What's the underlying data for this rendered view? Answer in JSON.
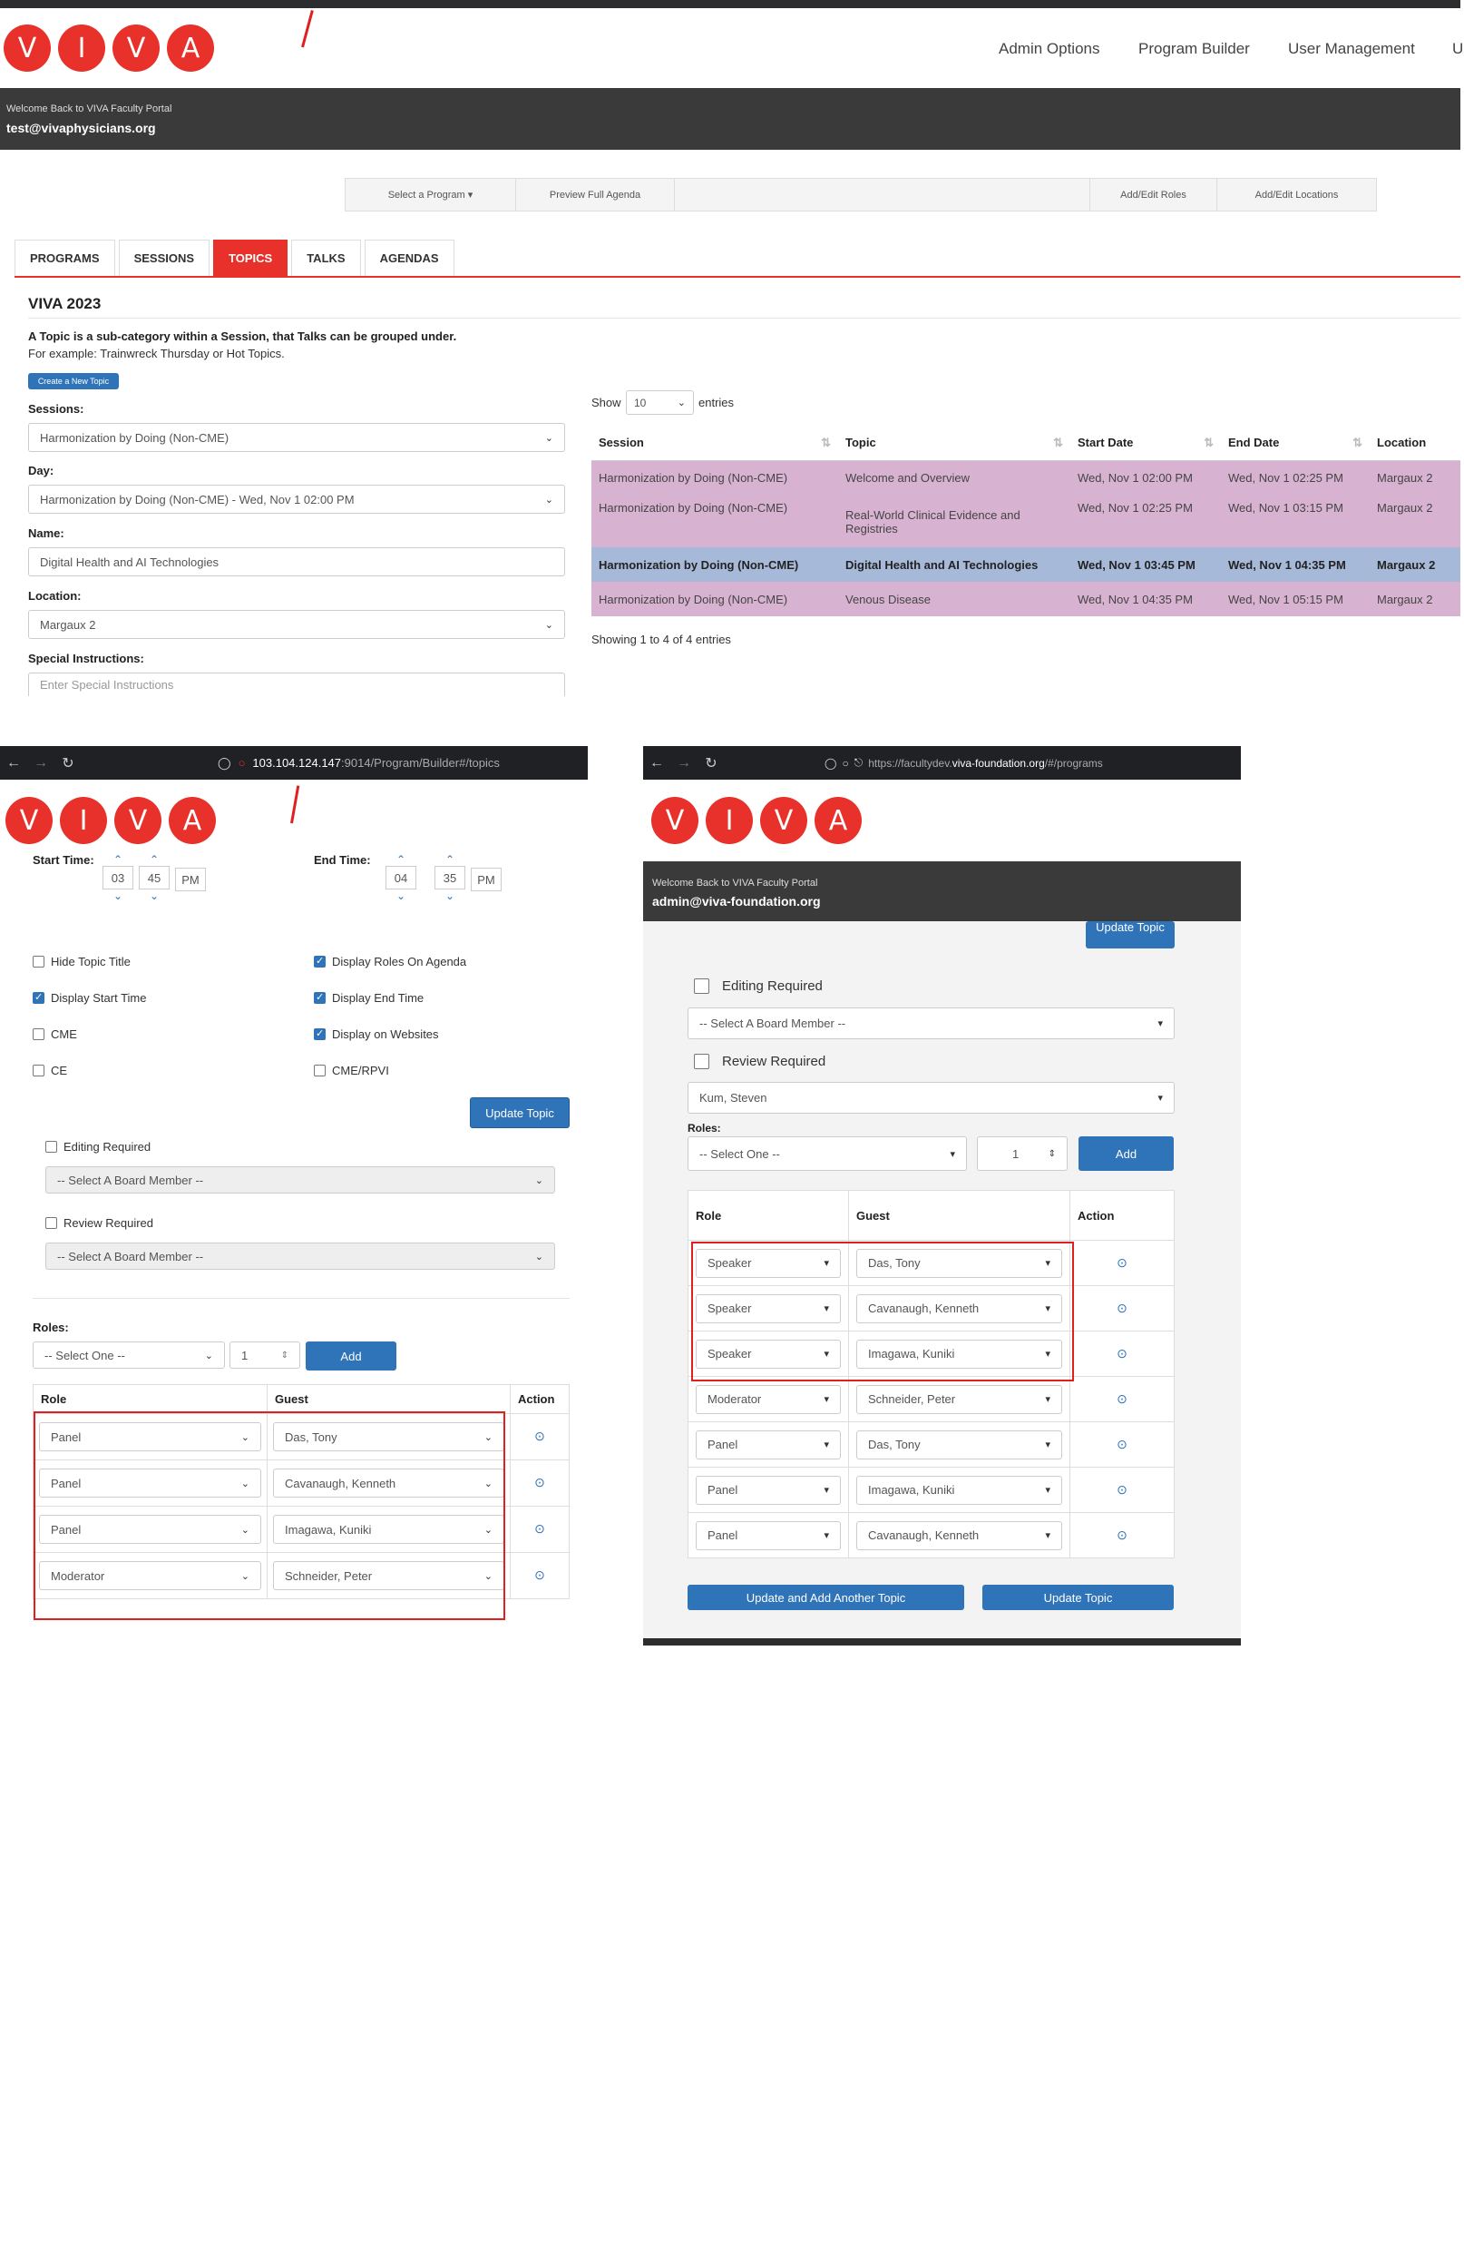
{
  "top": {
    "logo_letters": [
      "V",
      "I",
      "V",
      "A"
    ],
    "nav": [
      "Admin Options",
      "Program Builder",
      "User Management",
      "U"
    ],
    "welcome": "Welcome Back to VIVA Faculty Portal",
    "email": "test@vivaphysicians.org",
    "toolbar": [
      "Select a Program ▾",
      "Preview Full Agenda",
      "",
      "Add/Edit Roles",
      "Add/Edit Locations"
    ],
    "tabs": [
      "PROGRAMS",
      "SESSIONS",
      "TOPICS",
      "TALKS",
      "AGENDAS"
    ],
    "heading": "VIVA 2023",
    "desc_bold": "A Topic is a sub-category within a Session, that Talks can be grouped under.",
    "desc_example": "For example: Trainwreck Thursday or Hot Topics.",
    "create_button": "Create a New Topic",
    "form": {
      "sessions_label": "Sessions:",
      "sessions_value": "Harmonization by Doing (Non-CME)",
      "day_label": "Day:",
      "day_value": "Harmonization by Doing (Non-CME) - Wed, Nov 1 02:00 PM",
      "name_label": "Name:",
      "name_value": "Digital Health and AI Technologies",
      "location_label": "Location:",
      "location_value": "Margaux 2",
      "special_label": "Special Instructions:",
      "special_placeholder": "Enter Special Instructions"
    },
    "table": {
      "show_label": "Show",
      "show_value": "10",
      "entries_label": "entries",
      "headers": [
        "Session",
        "Topic",
        "Start Date",
        "End Date",
        "Location"
      ],
      "rows": [
        [
          "Harmonization by Doing (Non-CME)",
          "Welcome and Overview",
          "Wed, Nov 1 02:00 PM",
          "Wed, Nov 1 02:25 PM",
          "Margaux 2"
        ],
        [
          "Harmonization by Doing (Non-CME)",
          "Real-World Clinical Evidence and Registries",
          "Wed, Nov 1 02:25 PM",
          "Wed, Nov 1 03:15 PM",
          "Margaux 2"
        ],
        [
          "Harmonization by Doing (Non-CME)",
          "Digital Health and AI Technologies",
          "Wed, Nov 1 03:45 PM",
          "Wed, Nov 1 04:35 PM",
          "Margaux 2"
        ],
        [
          "Harmonization by Doing (Non-CME)",
          "Venous Disease",
          "Wed, Nov 1 04:35 PM",
          "Wed, Nov 1 05:15 PM",
          "Margaux 2"
        ]
      ],
      "footer": "Showing 1 to 4 of 4 entries"
    }
  },
  "left": {
    "url_host": "103.104.124.147",
    "url_rest": ":9014/Program/Builder#/topics",
    "start_label": "Start Time:",
    "start_h": "03",
    "start_m": "45",
    "start_ampm": "PM",
    "end_label": "End Time:",
    "end_h": "04",
    "end_m": "35",
    "end_ampm": "PM",
    "checks": [
      {
        "label": "Hide Topic Title",
        "checked": false
      },
      {
        "label": "Display Roles On Agenda",
        "checked": true
      },
      {
        "label": "Display Start Time",
        "checked": true
      },
      {
        "label": "Display End Time",
        "checked": true
      },
      {
        "label": "CME",
        "checked": false
      },
      {
        "label": "Display on Websites",
        "checked": true
      },
      {
        "label": "CE",
        "checked": false
      },
      {
        "label": "CME/RPVI",
        "checked": false
      }
    ],
    "update_button": "Update Topic",
    "editing_label": "Editing Required",
    "board_placeholder": "-- Select A Board Member --",
    "review_label": "Review Required",
    "review_placeholder": "-- Select A Board Member --",
    "roles_label": "Roles:",
    "roles_select": "-- Select One --",
    "roles_qty": "1",
    "add_button": "Add",
    "table_headers": [
      "Role",
      "Guest",
      "Action"
    ],
    "rows": [
      [
        "Panel",
        "Das, Tony"
      ],
      [
        "Panel",
        "Cavanaugh, Kenneth"
      ],
      [
        "Panel",
        "Imagawa, Kuniki"
      ],
      [
        "Moderator",
        "Schneider, Peter"
      ]
    ]
  },
  "right": {
    "url_prefix": "https://facultydev.",
    "url_host": "viva-foundation.org",
    "url_rest": "/#/programs",
    "welcome": "Welcome Back to VIVA Faculty Portal",
    "email": "admin@viva-foundation.org",
    "update_top_button": "Update Topic",
    "editing_label": "Editing Required",
    "board_placeholder": "-- Select A Board Member --",
    "review_label": "Review Required",
    "review_value": "Kum, Steven",
    "roles_label": "Roles:",
    "roles_select": "-- Select One --",
    "roles_qty": "1",
    "add_button": "Add",
    "table_headers": [
      "Role",
      "Guest",
      "Action"
    ],
    "rows": [
      [
        "Speaker",
        "Das, Tony"
      ],
      [
        "Speaker",
        "Cavanaugh, Kenneth"
      ],
      [
        "Speaker",
        "Imagawa, Kuniki"
      ],
      [
        "Moderator",
        "Schneider, Peter"
      ],
      [
        "Panel",
        "Das, Tony"
      ],
      [
        "Panel",
        "Imagawa, Kuniki"
      ],
      [
        "Panel",
        "Cavanaugh, Kenneth"
      ]
    ],
    "update_add_button": "Update and Add Another Topic",
    "update_button": "Update Topic"
  },
  "colors": {
    "brand_red": "#e8312a",
    "primary_blue": "#2f73b8",
    "row_pink": "#d8b3d1",
    "row_blue": "#a6b9d8"
  }
}
